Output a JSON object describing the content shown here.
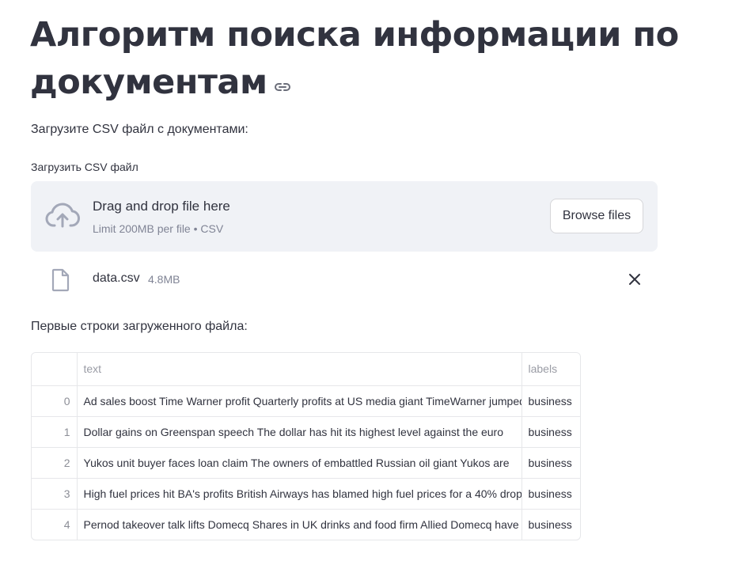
{
  "page": {
    "title": "Алгоритм поиска информации по документам",
    "intro_text": "Загрузите CSV файл с документами:"
  },
  "uploader": {
    "label": "Загрузить CSV файл",
    "drop_title": "Drag and drop file here",
    "drop_subtitle": "Limit 200MB per file • CSV",
    "browse_label": "Browse files",
    "uploaded_file": {
      "name": "data.csv",
      "size": "4.8MB"
    }
  },
  "preview": {
    "label": "Первые строки загруженного файла:",
    "columns": [
      "",
      "text",
      "labels"
    ],
    "rows": [
      {
        "index": "0",
        "text": "Ad sales boost Time Warner profit  Quarterly profits at US media giant TimeWarner jumped",
        "labels": "business"
      },
      {
        "index": "1",
        "text": "Dollar gains on Greenspan speech  The dollar has hit its highest level against the euro",
        "labels": "business"
      },
      {
        "index": "2",
        "text": "Yukos unit buyer faces loan claim  The owners of embattled Russian oil giant Yukos are",
        "labels": "business"
      },
      {
        "index": "3",
        "text": "High fuel prices hit BA's profits  British Airways has blamed high fuel prices for a 40% drop",
        "labels": "business"
      },
      {
        "index": "4",
        "text": "Pernod takeover talk lifts Domecq  Shares in UK drinks and food firm Allied Domecq have",
        "labels": "business"
      }
    ]
  },
  "icons": {
    "anchor": "link-icon",
    "upload": "cloud-upload-icon",
    "file": "file-icon",
    "remove": "close-icon"
  },
  "colors": {
    "text": "#31333f",
    "muted": "#808495",
    "dropzone_bg": "#f0f2f6",
    "icon": "#a3a8b8"
  }
}
